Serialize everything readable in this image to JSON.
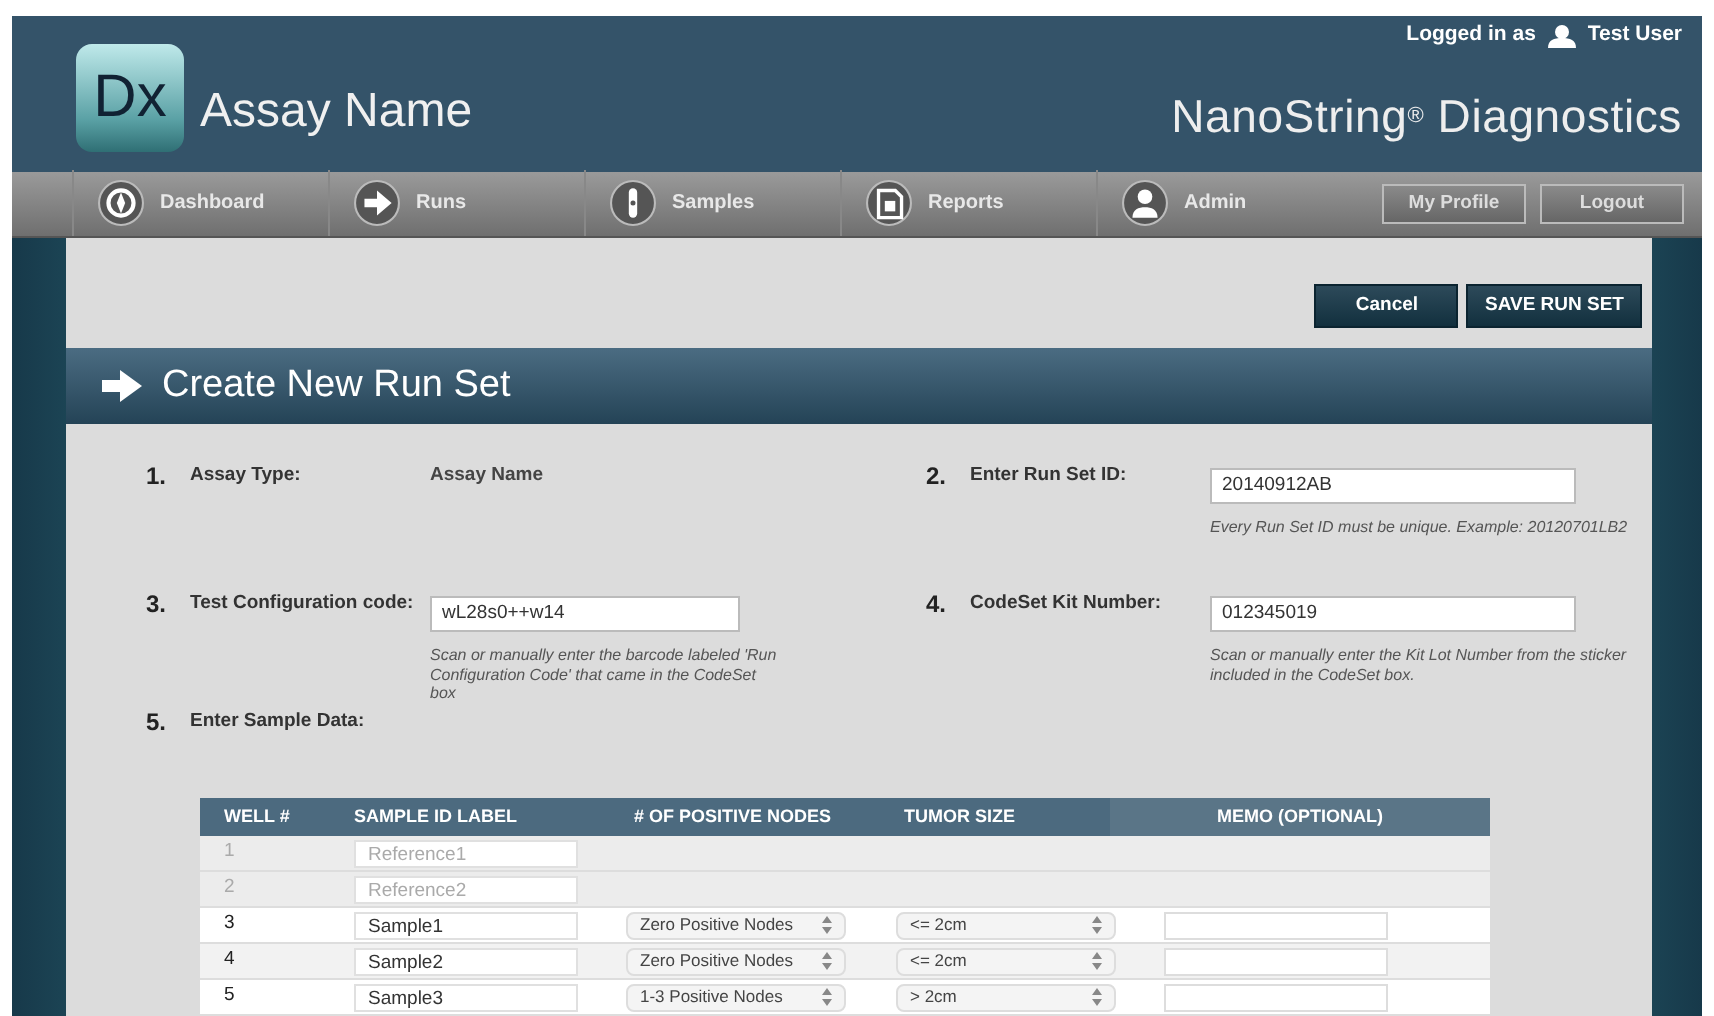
{
  "header": {
    "logo": "Dx",
    "app_title": "Assay Name",
    "login_label": "Logged in as",
    "user": "Test User",
    "brand": "NanoString$^{®}$ Diagnostics"
  },
  "nav": {
    "items": [
      {
        "label": "Dashboard",
        "kind": "compass"
      },
      {
        "label": "Runs",
        "kind": "arrow"
      },
      {
        "label": "Samples",
        "kind": "tubes"
      },
      {
        "label": "Reports",
        "kind": "document"
      },
      {
        "label": "Admin",
        "kind": "person"
      }
    ],
    "buttons": [
      "My Profile",
      "Logout"
    ]
  },
  "actions": [
    "Cancel",
    "SAVE RUN SET"
  ],
  "page_title": "Create New Run Set",
  "form_rows": [
    [
      {
        "number": "1.",
        "label": "Assay Type:",
        "kind": "static",
        "value": "Assay Name"
      },
      {
        "number": "2.",
        "label": "Enter Run Set ID:",
        "kind": "input",
        "value": "20140912AB",
        "hint": "Every Run Set ID must be unique. Example: 20120701LB2"
      }
    ],
    [
      {
        "number": "3.",
        "label": "Test Configuration code:",
        "kind": "input",
        "value": "wL28s0++w14",
        "hint": "Scan or manually enter the barcode labeled 'Run Configuration Code' that came in the CodeSet box"
      },
      {
        "number": "4.",
        "label": "CodeSet Kit Number:",
        "kind": "input",
        "value": "012345019",
        "hint": "Scan or manually enter the Kit Lot Number from the sticker included in the CodeSet box."
      }
    ],
    [
      {
        "number": "5.",
        "label": "Enter Sample Data:",
        "kind": "heading"
      }
    ]
  ],
  "table": {
    "columns": [
      "WELL #",
      "SAMPLE ID LABEL",
      "# OF POSITIVE NODES",
      "TUMOR SIZE",
      "MEMO (OPTIONAL)"
    ],
    "rows": [
      {
        "well": "1",
        "sample_id": "Reference1",
        "disabled": true
      },
      {
        "well": "2",
        "sample_id": "Reference2",
        "disabled": true
      },
      {
        "well": "3",
        "sample_id": "Sample1",
        "disabled": false,
        "nodes": "Zero Positive Nodes",
        "tumor_size": "<= 2cm"
      },
      {
        "well": "4",
        "sample_id": "Sample2",
        "disabled": false,
        "nodes": "Zero Positive Nodes",
        "tumor_size": "<= 2cm"
      },
      {
        "well": "5",
        "sample_id": "Sample3",
        "disabled": false,
        "nodes": "1-3 Positive Nodes",
        "tumor_size": "> 2cm"
      }
    ]
  }
}
